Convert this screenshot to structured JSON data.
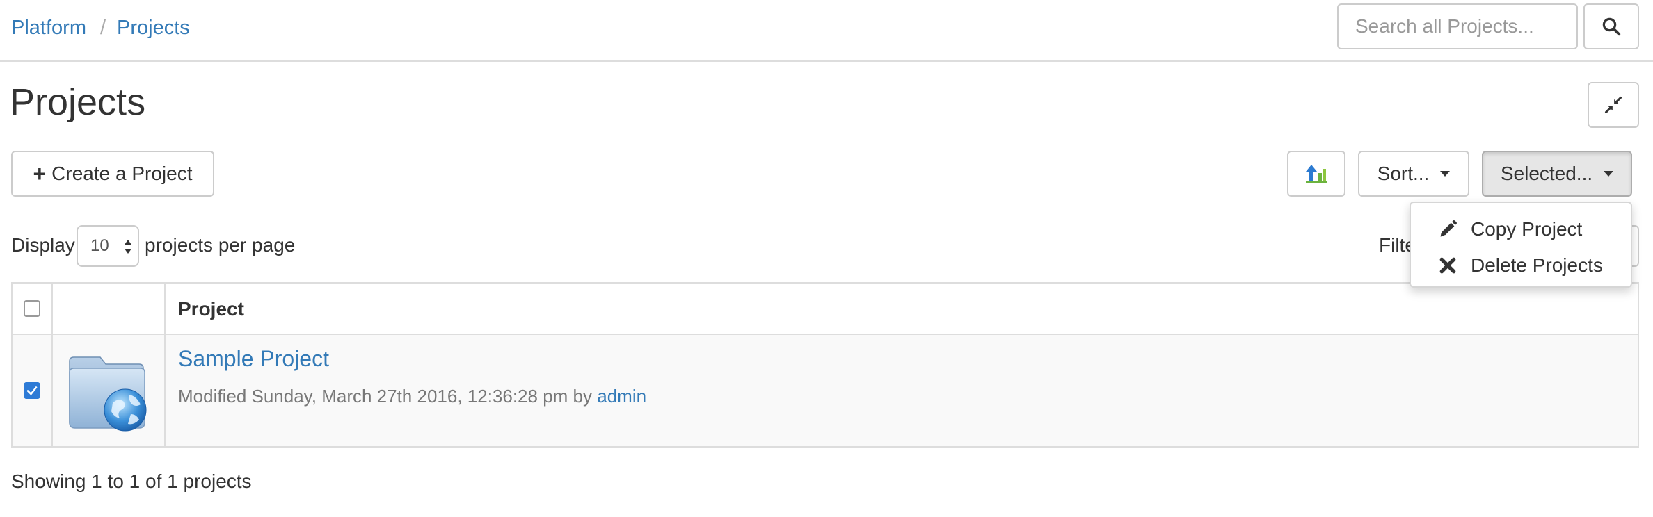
{
  "breadcrumb": {
    "root": "Platform",
    "separator": "/",
    "current": "Projects"
  },
  "search": {
    "placeholder": "Search all Projects...",
    "value": ""
  },
  "page": {
    "title": "Projects"
  },
  "toolbar": {
    "create_plus": "+",
    "create_label": "Create a Project",
    "upload_icon": "upload-icon",
    "sort_label": "Sort...",
    "selected_label": "Selected..."
  },
  "selected_menu": {
    "items": [
      {
        "label": "Copy Project",
        "icon": "pencil-icon"
      },
      {
        "label": "Delete Projects",
        "icon": "times-icon"
      }
    ]
  },
  "pagination": {
    "display_prefix": "Display",
    "per_page_value": "10",
    "display_suffix": "projects per page",
    "filter_label": "Filte"
  },
  "table": {
    "columns": [
      "",
      "",
      "Project"
    ],
    "header_checked": false,
    "rows": [
      {
        "checked": true,
        "name": "Sample Project",
        "meta_prefix": "Modified Sunday, March 27th 2016, 12:36:28 pm by",
        "author": "admin",
        "thumbnail_icon": "network-folder-icon"
      }
    ]
  },
  "footer": {
    "showing": "Showing 1 to 1 of 1 projects"
  },
  "colors": {
    "link": "#337ab7",
    "border": "#dddddd",
    "checkbox_checked": "#2e7bd6",
    "row_bg": "#f9f9f9"
  }
}
